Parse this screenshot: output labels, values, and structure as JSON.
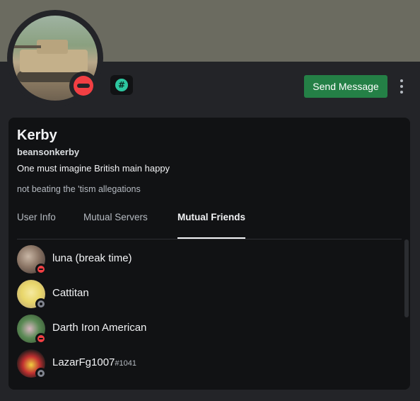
{
  "profile": {
    "display_name": "Kerby",
    "username": "beansonkerby",
    "bio_line": "One must imagine British main happy",
    "custom_status": "not beating the 'tism allegations",
    "status": "dnd",
    "badge_glyph": "#"
  },
  "actions": {
    "send_message_label": "Send Message",
    "more_icon": "more-vertical-icon"
  },
  "tabs": [
    {
      "label": "User Info",
      "active": false
    },
    {
      "label": "Mutual Servers",
      "active": false
    },
    {
      "label": "Mutual Friends",
      "active": true
    }
  ],
  "mutual_friends": [
    {
      "name": "luna (break time)",
      "tag": "",
      "status": "dnd"
    },
    {
      "name": "Cattitan",
      "tag": "",
      "status": "offline"
    },
    {
      "name": "Darth Iron American",
      "tag": "",
      "status": "dnd"
    },
    {
      "name": "LazarFg1007",
      "tag": "#1041",
      "status": "offline"
    }
  ],
  "colors": {
    "banner": "#6b6b60",
    "send_button": "#248046",
    "dnd": "#f23f43",
    "offline": "#80848e",
    "badge": "#2dc7a0"
  }
}
